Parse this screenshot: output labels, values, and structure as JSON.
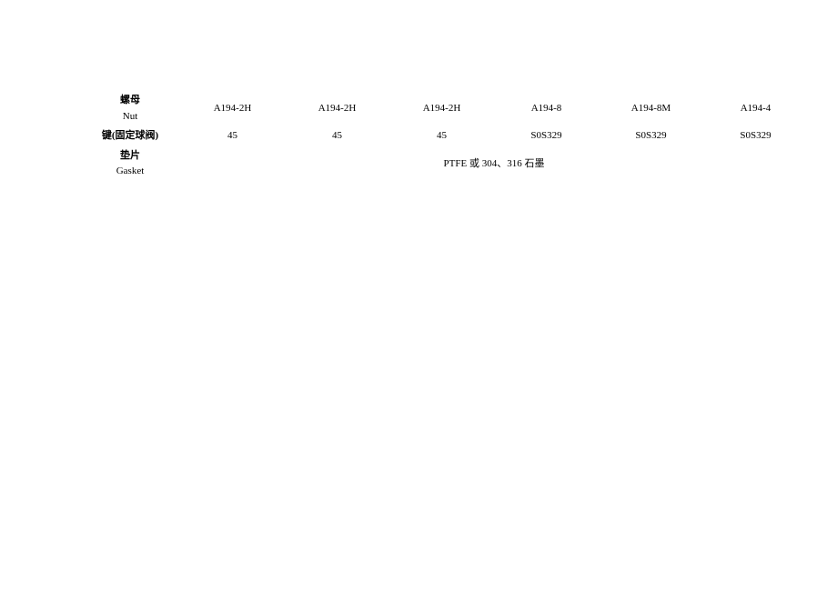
{
  "rows": [
    {
      "label_cn": "螺母",
      "label_en": "Nut",
      "cells": [
        "A194-2H",
        "A194-2H",
        "A194-2H",
        "A194-8",
        "A194-8M",
        "A194-4"
      ]
    },
    {
      "label_cn": "键(固定球阀)",
      "label_en": "",
      "cells": [
        "45",
        "45",
        "45",
        "S0S329",
        "S0S329",
        "S0S329"
      ]
    },
    {
      "label_cn": "垫片",
      "label_en": "Gasket",
      "spanned_cell": "PTFE 或 304、316 石墨"
    }
  ]
}
